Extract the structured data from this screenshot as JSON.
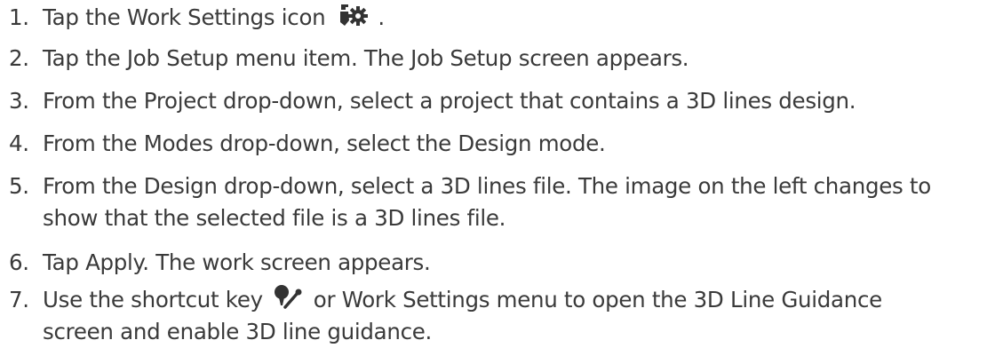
{
  "steps": [
    {
      "number": "1.",
      "text": "Tap the Work Settings icon",
      "suffix": ".",
      "icon": "work-settings-icon"
    },
    {
      "number": "2.",
      "text": "Tap the Job Setup menu item. The Job Setup screen appears."
    },
    {
      "number": "3.",
      "text": "From the Project drop-down, select a project that contains a 3D lines design."
    },
    {
      "number": "4.",
      "text": "From the Modes drop-down, select the Design mode."
    },
    {
      "number": "5.",
      "line1": "From the Design drop-down, select a 3D lines file. The image on the left changes to",
      "line2": "show that the selected file is a 3D lines file."
    },
    {
      "number": "6.",
      "text": "Tap Apply. The work screen appears."
    },
    {
      "number": "7.",
      "before_icon": "Use the shortcut key",
      "after_icon": "or Work Settings menu to open the 3D Line Guidance",
      "line2": "screen and enable 3D line guidance.",
      "icon": "line-guidance-shortcut-icon"
    }
  ],
  "colors": {
    "text": "#3a3a3a",
    "icon": "#333333"
  }
}
